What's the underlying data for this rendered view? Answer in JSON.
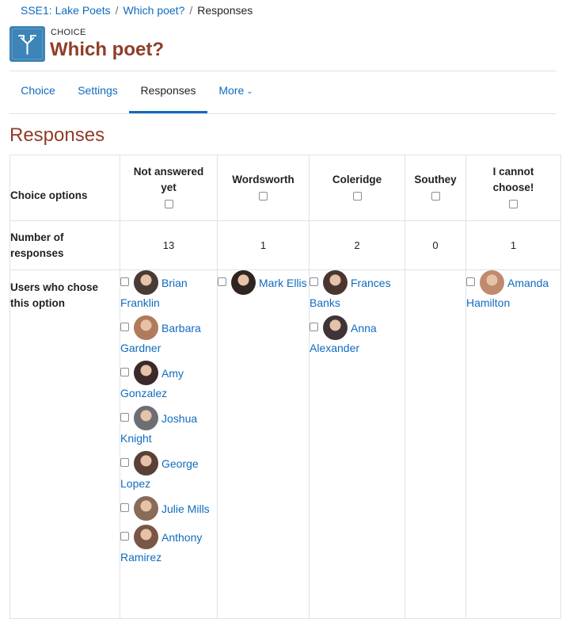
{
  "breadcrumb": {
    "items": [
      "SSE1: Lake Poets",
      "Which poet?",
      "Responses"
    ]
  },
  "activity": {
    "icon": "choice-signpost-icon",
    "purpose": "CHOICE",
    "title": "Which poet?"
  },
  "tabs": [
    {
      "label": "Choice"
    },
    {
      "label": "Settings"
    },
    {
      "label": "Responses"
    },
    {
      "label": "More"
    }
  ],
  "section_title": "Responses",
  "table": {
    "row_labels": {
      "options": "Choice options",
      "count": "Number of responses",
      "users": "Users who chose this option"
    },
    "columns": [
      {
        "header": "Not answered yet",
        "count": "13",
        "users": [
          {
            "name": "Brian Franklin",
            "avatar": "#4a3a35"
          },
          {
            "name": "Barbara Gardner",
            "avatar": "#b07a5c"
          },
          {
            "name": "Amy Gonzalez",
            "avatar": "#3b2a2a"
          },
          {
            "name": "Joshua Knight",
            "avatar": "#6d6e74"
          },
          {
            "name": "George Lopez",
            "avatar": "#5a4036"
          },
          {
            "name": "Julie Mills",
            "avatar": "#8a6a58"
          },
          {
            "name": "Anthony Ramirez",
            "avatar": "#7a5646"
          }
        ]
      },
      {
        "header": "Wordsworth",
        "count": "1",
        "users": [
          {
            "name": "Mark Ellis",
            "avatar": "#2f2420"
          }
        ]
      },
      {
        "header": "Coleridge",
        "count": "2",
        "users": [
          {
            "name": "Frances Banks",
            "avatar": "#4b3530"
          },
          {
            "name": "Anna Alexander",
            "avatar": "#3e3438"
          }
        ]
      },
      {
        "header": "Southey",
        "count": "0",
        "users": []
      },
      {
        "header": "I cannot choose!",
        "count": "1",
        "users": [
          {
            "name": "Amanda Hamilton",
            "avatar": "#c08a6e"
          }
        ]
      }
    ]
  },
  "colors": {
    "link": "#0f6cbf",
    "title": "#8f3d28",
    "icon_bg": "#3d84b8",
    "border": "#dee2e6"
  }
}
